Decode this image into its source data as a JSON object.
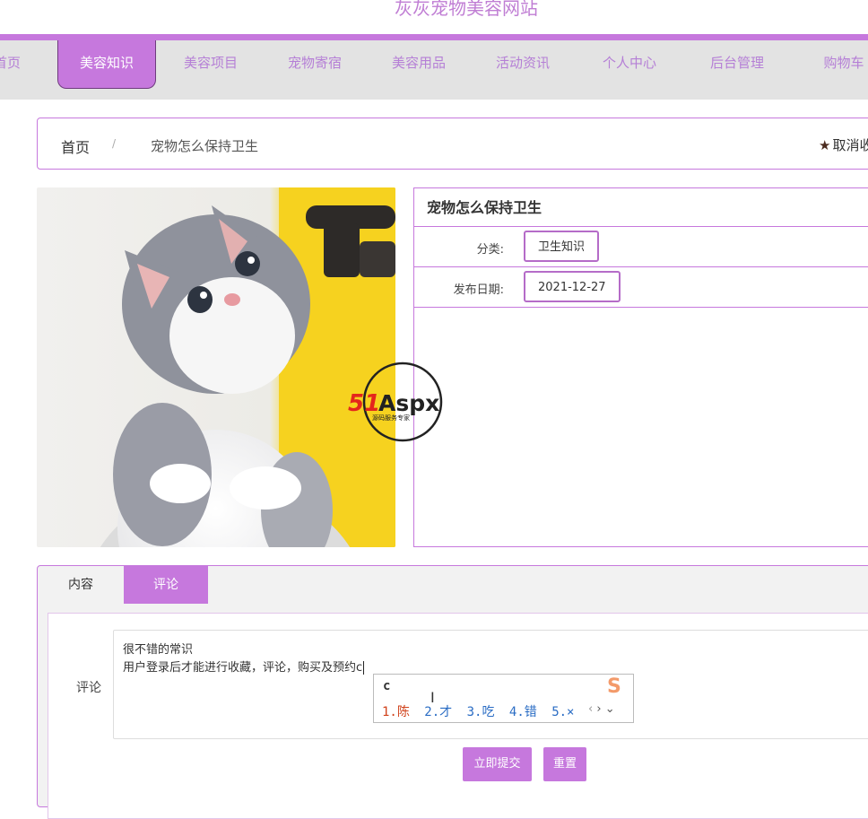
{
  "site": {
    "title": "灰灰宠物美容网站"
  },
  "nav": {
    "items": [
      {
        "label": "首页"
      },
      {
        "label": "美容知识",
        "active": true
      },
      {
        "label": "美容项目"
      },
      {
        "label": "宠物寄宿"
      },
      {
        "label": "美容用品"
      },
      {
        "label": "活动资讯"
      },
      {
        "label": "个人中心"
      },
      {
        "label": "后台管理"
      },
      {
        "label": "购物车"
      }
    ]
  },
  "breadcrumb": {
    "home": "首页",
    "separator": "/",
    "current": "宠物怎么保持卫生",
    "favorite_label": "取消收藏"
  },
  "article": {
    "title": "宠物怎么保持卫生",
    "category_label": "分类:",
    "category_value": "卫生知识",
    "date_label": "发布日期:",
    "date_value": "2021-12-27"
  },
  "watermark": {
    "text_red": "51",
    "text_dark": "Aspx",
    "subtitle": "源码服务专家"
  },
  "tabs": [
    {
      "label": "内容"
    },
    {
      "label": "评论",
      "active": true
    }
  ],
  "comment": {
    "label": "评论",
    "line1": "很不错的常识",
    "line2": "用户登录后才能进行收藏，评论，购买及预约c"
  },
  "ime": {
    "input": "c",
    "candidates": [
      "1.陈",
      "2.才",
      "3.吃",
      "4.错",
      "5.×"
    ],
    "logo": "S"
  },
  "buttons": {
    "submit": "立即提交",
    "reset": "重置"
  },
  "colors": {
    "accent": "#c678dd",
    "nav_bg": "#e3e3e3",
    "nav_text": "#b57fd6"
  }
}
